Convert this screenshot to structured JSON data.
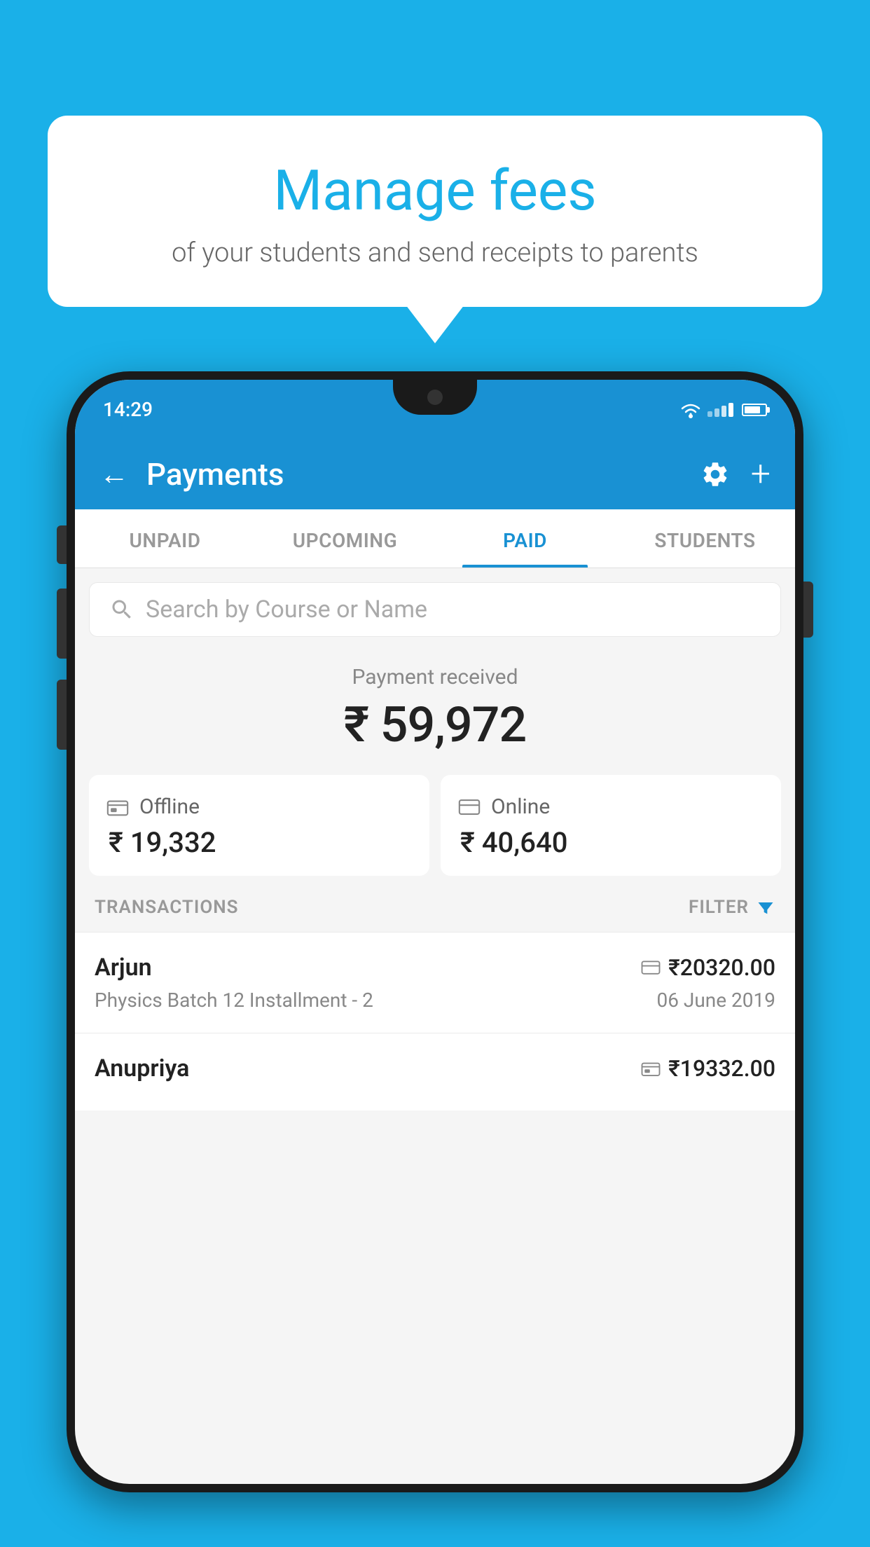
{
  "background_color": "#1ab0e8",
  "speech_bubble": {
    "title": "Manage fees",
    "subtitle": "of your students and send receipts to parents"
  },
  "phone": {
    "status_bar": {
      "time": "14:29"
    },
    "header": {
      "title": "Payments",
      "back_label": "←",
      "settings_icon": "gear",
      "add_icon": "+"
    },
    "tabs": [
      {
        "label": "UNPAID",
        "active": false
      },
      {
        "label": "UPCOMING",
        "active": false
      },
      {
        "label": "PAID",
        "active": true
      },
      {
        "label": "STUDENTS",
        "active": false
      }
    ],
    "search": {
      "placeholder": "Search by Course or Name"
    },
    "payment_summary": {
      "label": "Payment received",
      "amount": "₹ 59,972"
    },
    "payment_modes": [
      {
        "icon": "offline",
        "label": "Offline",
        "amount": "₹ 19,332"
      },
      {
        "icon": "online",
        "label": "Online",
        "amount": "₹ 40,640"
      }
    ],
    "transactions_label": "TRANSACTIONS",
    "filter_label": "FILTER",
    "transactions": [
      {
        "name": "Arjun",
        "course": "Physics Batch 12 Installment - 2",
        "amount": "₹20320.00",
        "date": "06 June 2019",
        "mode": "online"
      },
      {
        "name": "Anupriya",
        "course": "",
        "amount": "₹19332.00",
        "date": "",
        "mode": "offline"
      }
    ]
  }
}
